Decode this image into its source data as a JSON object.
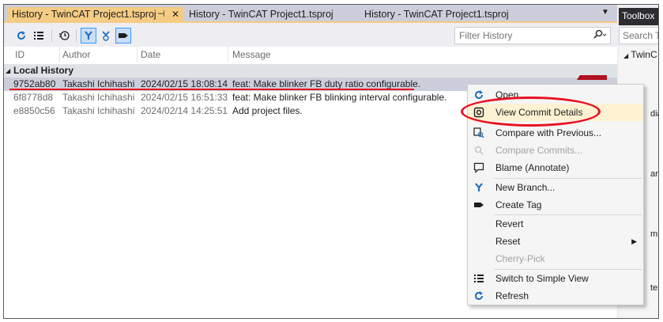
{
  "tabs": [
    {
      "label": "History - TwinCAT Project1.tsproj",
      "pin": "⊣",
      "close": "✕"
    },
    {
      "label": "History - TwinCAT Project1.tsproj"
    },
    {
      "label": "History - TwinCAT Project1.tsproj"
    }
  ],
  "tab_menu": "▼",
  "filter": {
    "placeholder": "Filter History",
    "icon": "🔍",
    "dropdown": "▾"
  },
  "columns": {
    "id": "ID",
    "author": "Author",
    "date": "Date",
    "message": "Message"
  },
  "group": {
    "label": "Local History",
    "arrow": "◢"
  },
  "commits": [
    {
      "id": "9752ab80",
      "author": "Takashi Ichihashi",
      "date": "2024/02/15 18:08:14",
      "message": "feat: Make blinker FB duty ratio configurable."
    },
    {
      "id": "6f8778d8",
      "author": "Takashi Ichihashi",
      "date": "2024/02/15 16:51:33",
      "message": "feat: Make blinker FB blinking interval configurable."
    },
    {
      "id": "e8850c56",
      "author": "Takashi Ichihashi",
      "date": "2024/02/14 14:25:51",
      "message": "Add project files."
    }
  ],
  "toolbox": {
    "title": "Toolbox",
    "search": "Search T",
    "node": "TwinC",
    "node_arrow": "◢",
    "fragments": [
      "dia",
      "art",
      "mm",
      "ter"
    ]
  },
  "context_menu": [
    {
      "label": "Open",
      "icon": "refresh-blue-icon",
      "enabled": true
    },
    {
      "label": "View Commit Details",
      "icon": "commit-details-icon",
      "enabled": true,
      "highlighted": true
    },
    {
      "label": "Compare with Previous...",
      "icon": "compare-icon",
      "enabled": true
    },
    {
      "label": "Compare Commits...",
      "icon": "compare-commits-icon",
      "enabled": false
    },
    {
      "label": "Blame (Annotate)",
      "icon": "blame-icon",
      "enabled": true
    },
    {
      "label": "New Branch...",
      "icon": "branch-icon",
      "enabled": true
    },
    {
      "label": "Create Tag",
      "icon": "tag-icon",
      "enabled": true
    },
    {
      "label": "Revert",
      "enabled": true
    },
    {
      "label": "Reset",
      "enabled": true,
      "submenu": "▶"
    },
    {
      "label": "Cherry-Pick",
      "enabled": false
    },
    {
      "label": "Switch to Simple View",
      "icon": "list-view-icon",
      "enabled": true
    },
    {
      "label": "Refresh",
      "icon": "refresh-icon",
      "enabled": true
    }
  ],
  "colors": {
    "accent": "#f5cc84",
    "annotation": "#e81123",
    "selection": "#cccedb",
    "icon_blue": "#1e6fc0"
  }
}
